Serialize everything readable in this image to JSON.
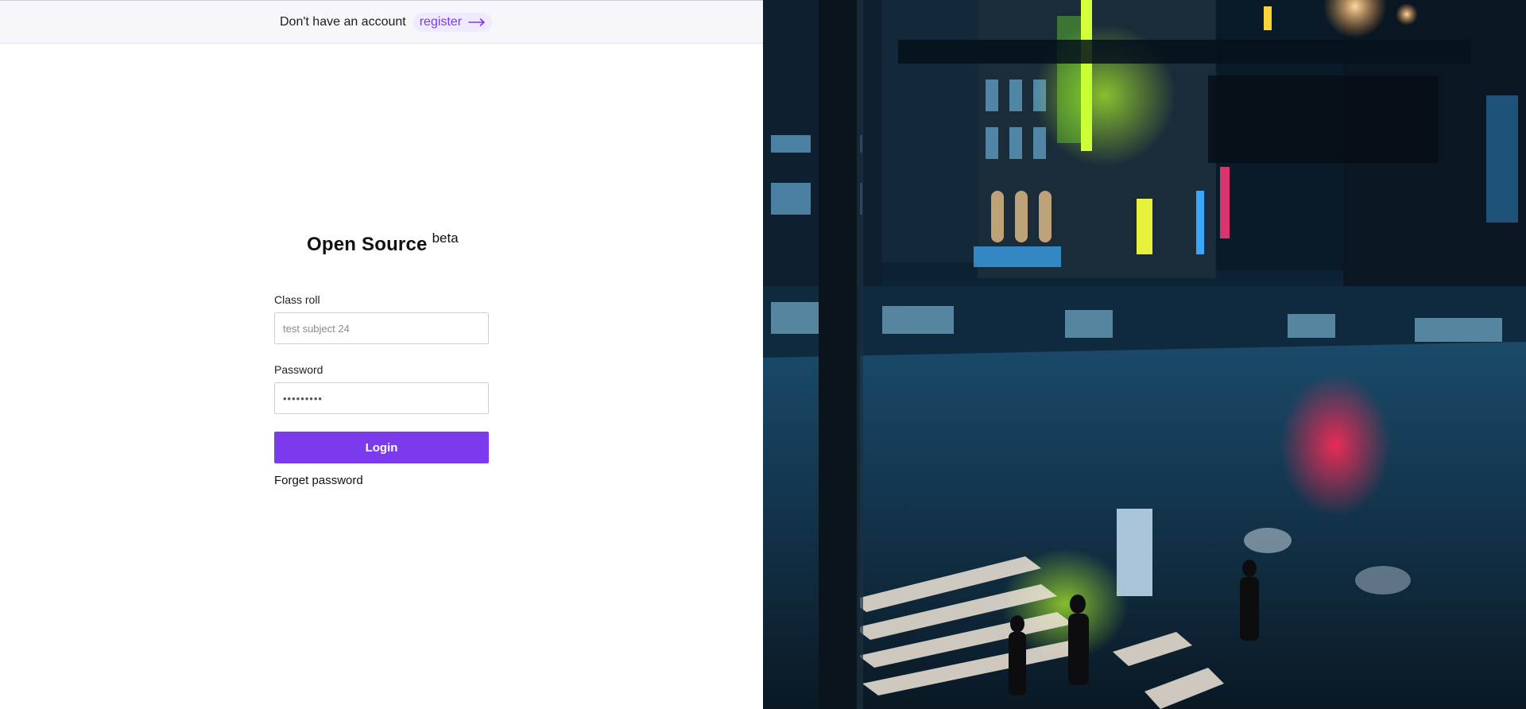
{
  "header": {
    "prompt": "Don't have an account",
    "register_label": "register",
    "register_icon": "arrow-right-icon"
  },
  "brand": {
    "title": "Open Source",
    "tag": "beta"
  },
  "form": {
    "class_roll": {
      "label": "Class roll",
      "value": "",
      "placeholder": "test subject 24"
    },
    "password": {
      "label": "Password",
      "value": "•••••••••"
    },
    "login_label": "Login",
    "forgot_label": "Forget password"
  },
  "colors": {
    "accent": "#7c3aed",
    "register_bg": "#efeaff",
    "topbar_bg": "#f7f7fb"
  }
}
